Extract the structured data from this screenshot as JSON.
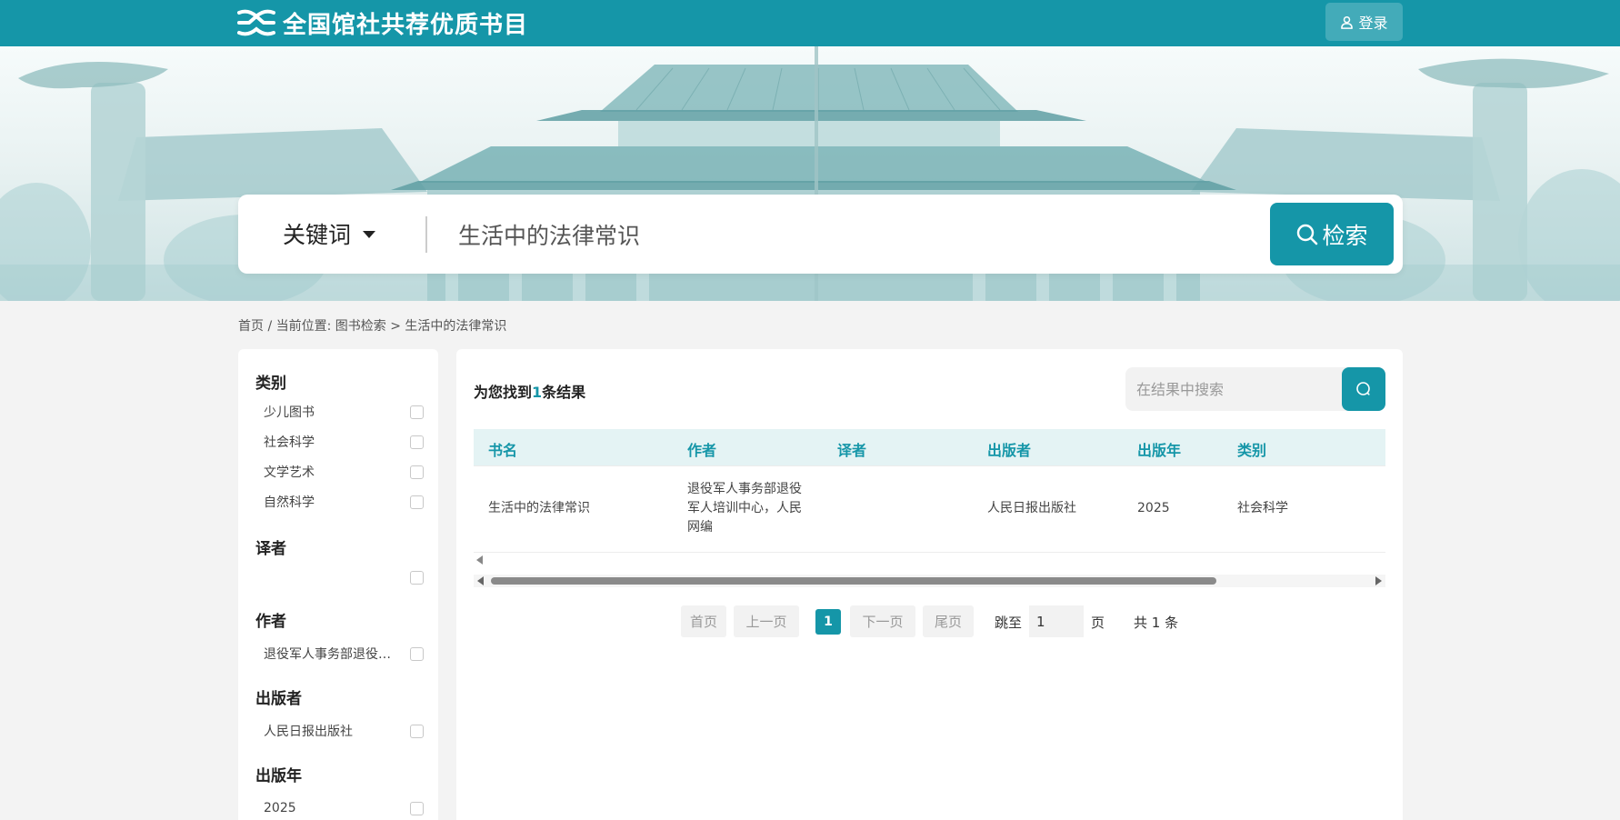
{
  "header": {
    "site_title": "全国馆社共荐优质书目",
    "login_label": "登录"
  },
  "search": {
    "field_selector": "关键词",
    "query": "生活中的法律常识",
    "button_label": "检索"
  },
  "breadcrumb": "首页 / 当前位置: 图书检索 > 生活中的法律常识",
  "facets": {
    "category": {
      "title": "类别",
      "items": [
        "少儿图书",
        "社会科学",
        "文学艺术",
        "自然科学"
      ]
    },
    "translator": {
      "title": "译者",
      "items": [
        ""
      ]
    },
    "author": {
      "title": "作者",
      "items": [
        "退役军人事务部退役军人培训中心，人民网编"
      ]
    },
    "publisher": {
      "title": "出版者",
      "items": [
        "人民日报出版社"
      ]
    },
    "year": {
      "title": "出版年",
      "items": [
        "2025"
      ]
    }
  },
  "results": {
    "prefix": "为您找到",
    "count": "1",
    "suffix": "条结果",
    "within_placeholder": "在结果中搜索",
    "columns": [
      "书名",
      "作者",
      "译者",
      "出版者",
      "出版年",
      "类别"
    ],
    "rows": [
      {
        "title": "生活中的法律常识",
        "author": "退役军人事务部退役军人培训中心，人民网编",
        "translator": "",
        "publisher": "人民日报出版社",
        "year": "2025",
        "category": "社会科学"
      }
    ]
  },
  "pagination": {
    "first": "首页",
    "prev": "上一页",
    "current": "1",
    "next": "下一页",
    "last": "尾页",
    "jump_label": "跳至",
    "jump_value": "1",
    "page_unit": "页",
    "total": "共 1 条"
  },
  "colors": {
    "primary": "#1596a8",
    "header_bg": "#1596a8",
    "table_header_bg": "#e4f3f4",
    "page_bg": "#f3f3f3"
  }
}
